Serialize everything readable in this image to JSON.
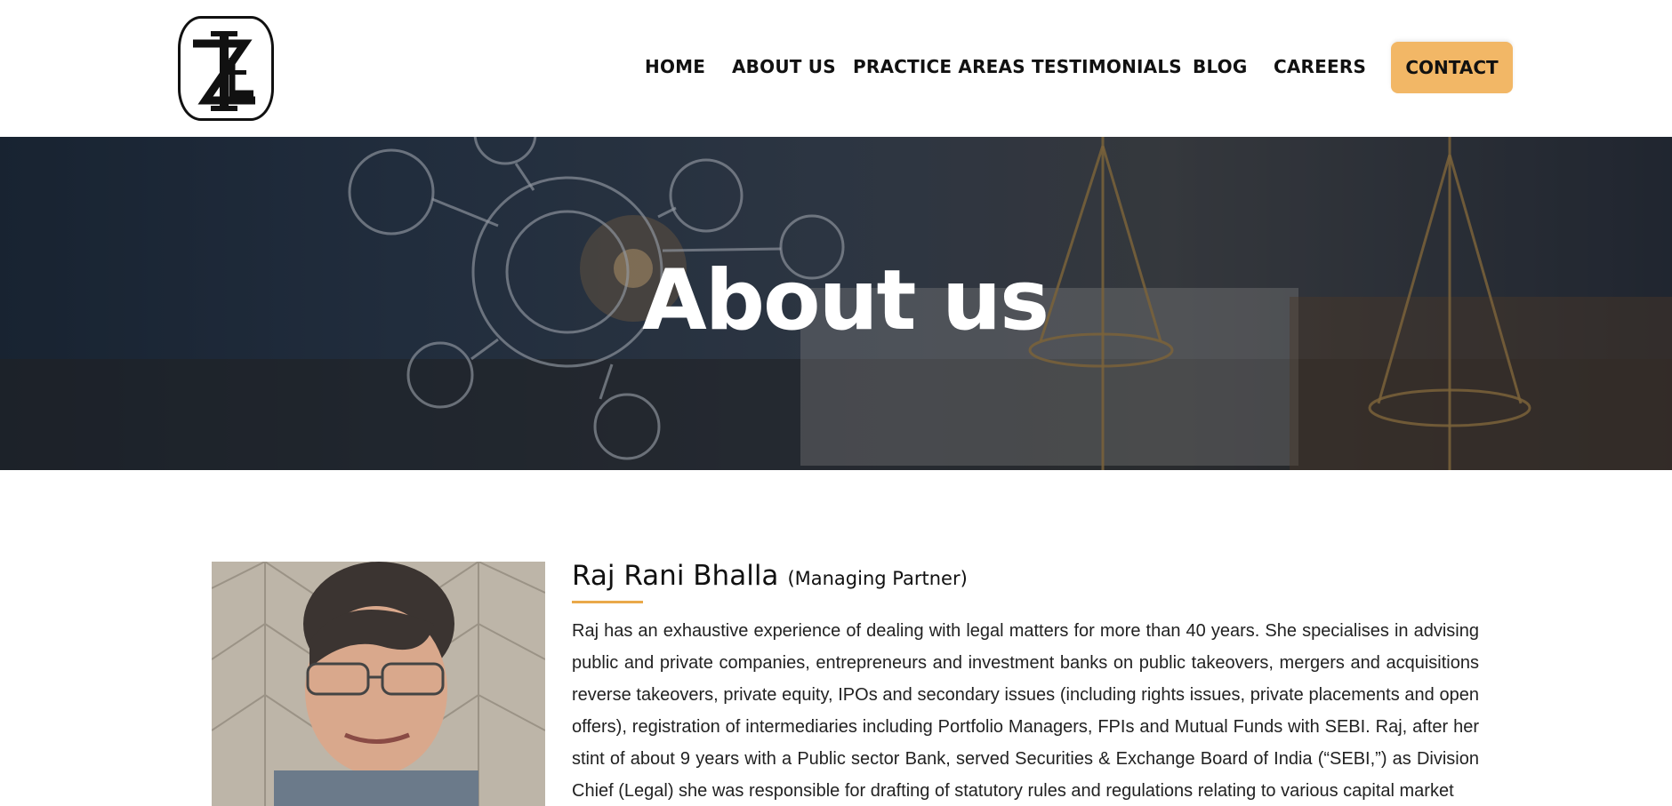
{
  "colors": {
    "accent": "#f2b766",
    "text": "#111111",
    "underline": "#e9a94a"
  },
  "header": {
    "logo_icon": "firm-monogram-logo",
    "nav": [
      "HOME",
      "ABOUT US",
      "PRACTICE AREAS",
      "TESTIMONIALS",
      "BLOG",
      "CAREERS"
    ],
    "contact_label": "CONTACT"
  },
  "hero": {
    "title": "About us"
  },
  "profile": {
    "name": "Raj Rani Bhalla",
    "role": "(Managing Partner)",
    "bio": "Raj has an exhaustive experience of dealing with legal matters for more than 40 years. She specialises in advising public and private companies, entrepreneurs and investment banks on public takeovers, mergers and acquisitions reverse takeovers, private equity, IPOs and secondary issues (including rights issues, private placements and open offers), registration of intermediaries including Portfolio Managers, FPIs and Mutual Funds with SEBI. Raj, after her stint of about 9 years with a Public sector Bank, served Securities & Exchange Board of India (“SEBI,”) as Division Chief (Legal) she was responsible for drafting of statutory rules and regulations relating to various capital market"
  }
}
